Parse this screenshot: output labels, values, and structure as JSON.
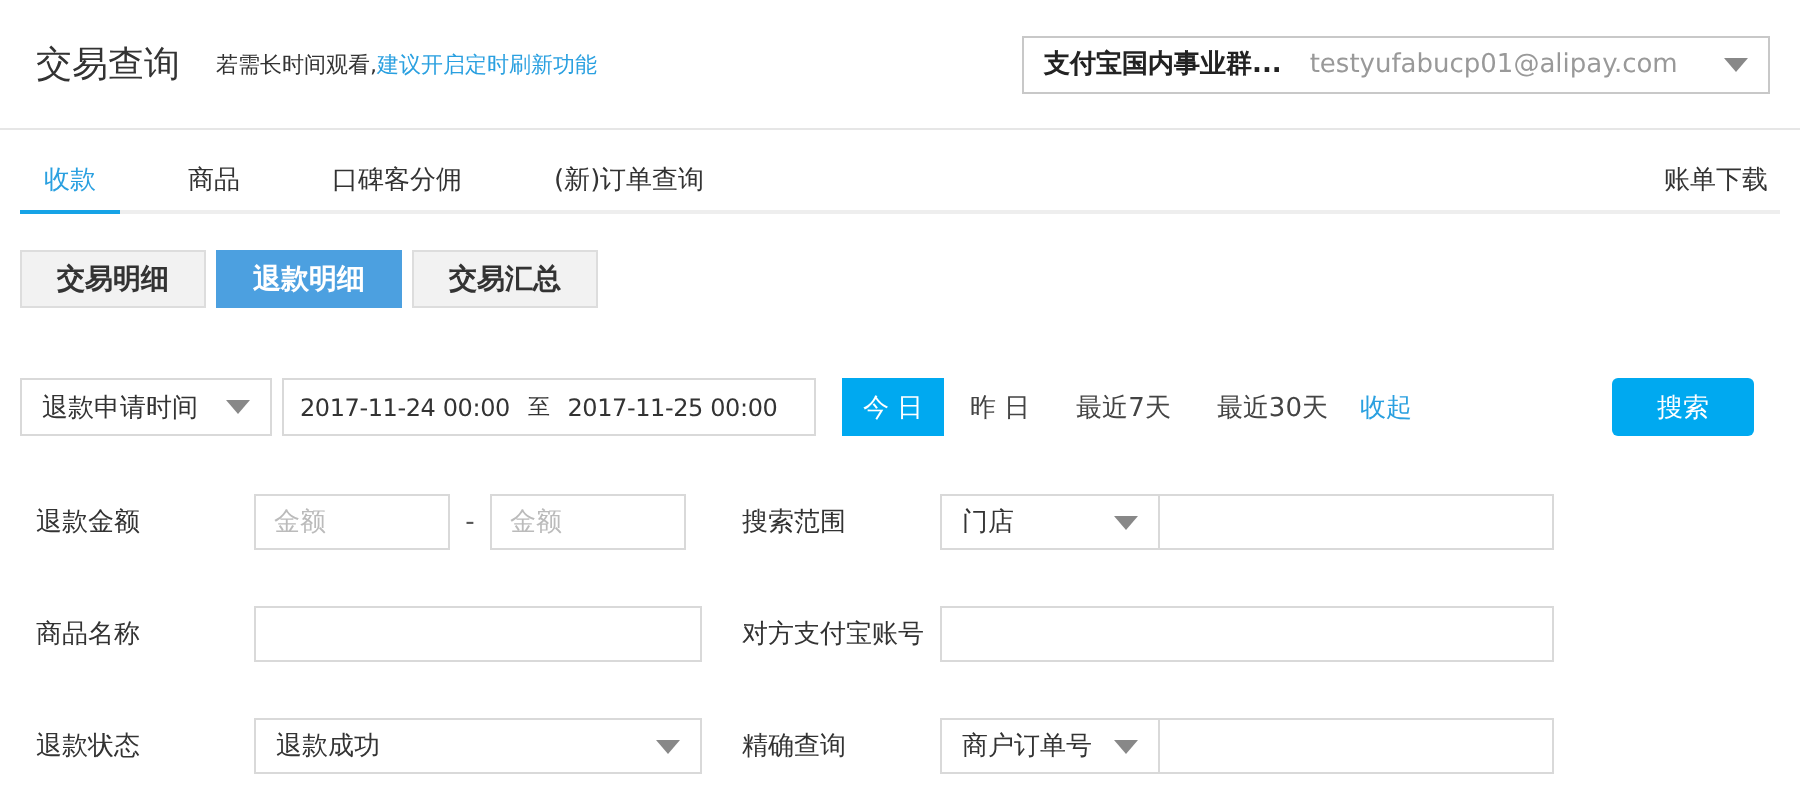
{
  "header": {
    "title": "交易查询",
    "notice": "若需长时间观看,",
    "notice_link": "建议开启定时刷新功能",
    "account": {
      "name": "支付宝国内事业群...",
      "email": "testyufabucp01@alipay.com"
    }
  },
  "tabs": [
    {
      "label": "收款",
      "selected": true
    },
    {
      "label": "商品",
      "selected": false
    },
    {
      "label": "口碑客分佣",
      "selected": false
    },
    {
      "label": "(新)订单查询",
      "selected": false
    }
  ],
  "download_link": "账单下载",
  "views": [
    {
      "label": "交易明细",
      "selected": false
    },
    {
      "label": "退款明细",
      "selected": true
    },
    {
      "label": "交易汇总",
      "selected": false
    }
  ],
  "date_filter": {
    "field": "退款申请时间",
    "start": "2017-11-24 00:00",
    "separator": "至",
    "end": "2017-11-25 00:00",
    "quick": [
      {
        "label": "今 日",
        "selected": true
      },
      {
        "label": "昨 日",
        "selected": false
      },
      {
        "label": "最近7天",
        "selected": false
      },
      {
        "label": "最近30天",
        "selected": false
      }
    ],
    "collapse": "收起",
    "search": "搜索"
  },
  "form_rows": [
    {
      "left": {
        "label": "退款金额",
        "kind": "range",
        "placeholders": [
          "金额",
          "金额"
        ],
        "separator": "-"
      },
      "right": {
        "label": "搜索范围",
        "kind": "select-text",
        "value": "门店"
      }
    },
    {
      "left": {
        "label": "商品名称",
        "kind": "text"
      },
      "right": {
        "label": "对方支付宝账号",
        "kind": "text"
      }
    },
    {
      "left": {
        "label": "退款状态",
        "kind": "select",
        "value": "退款成功"
      },
      "right": {
        "label": "精确查询",
        "kind": "select-text",
        "value": "商户订单号"
      }
    }
  ]
}
